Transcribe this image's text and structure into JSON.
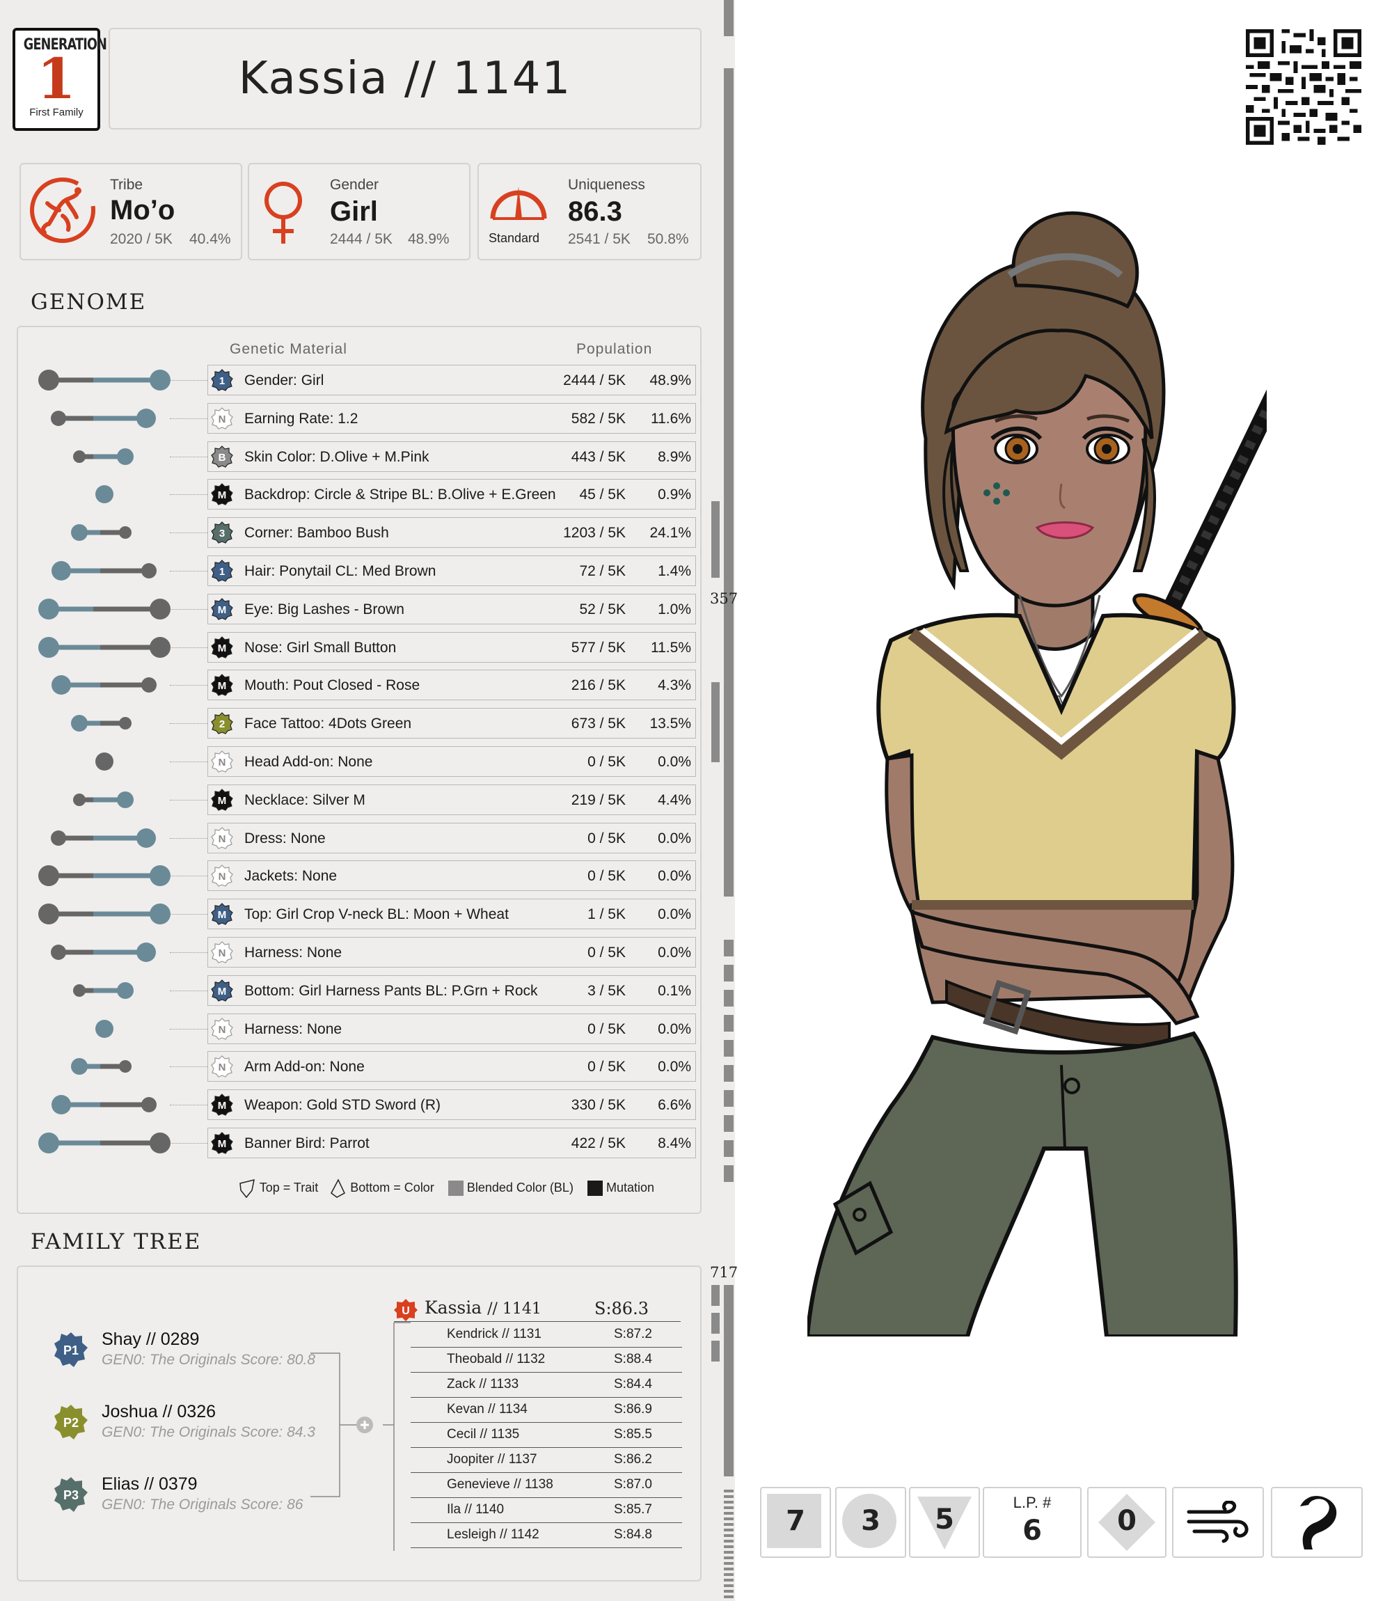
{
  "header": {
    "generation_label": "GENERATION",
    "generation_number": "1",
    "generation_family": "First Family",
    "title": "Kassia  //  1141"
  },
  "stats": {
    "tribe": {
      "label": "Tribe",
      "value": "Mo’o",
      "count": "2020 / 5K",
      "percent": "40.4%"
    },
    "gender": {
      "label": "Gender",
      "value": "Girl",
      "count": "2444 / 5K",
      "percent": "48.9%"
    },
    "uniqueness": {
      "label": "Uniqueness",
      "value": "86.3",
      "gauge_label": "Standard",
      "count": "2541 / 5K",
      "percent": "50.8%"
    }
  },
  "genome": {
    "section_title": "GENOME",
    "col_material": "Genetic Material",
    "col_population": "Population",
    "rows": [
      {
        "badge": "1",
        "badge_color": "#3f5f86",
        "name": "Gender: Girl",
        "pop": "2444 / 5K",
        "pct": "48.9%",
        "allele": "LR"
      },
      {
        "badge": "N",
        "badge_color": "#ffffff",
        "name": "Earning Rate: 1.2",
        "pop": "582 / 5K",
        "pct": "11.6%",
        "allele": "lr"
      },
      {
        "badge": "B",
        "badge_color": "#8a8a8a",
        "name": "Skin Color: D.Olive + M.Pink",
        "pop": "443 / 5K",
        "pct": "8.9%",
        "allele": "s"
      },
      {
        "badge": "M",
        "badge_color": "#111111",
        "name": "Backdrop: Circle & Stripe BL: B.Olive + E.Green",
        "pop": "45 / 5K",
        "pct": "0.9%",
        "allele": "dot_b"
      },
      {
        "badge": "3",
        "badge_color": "#566f6a",
        "name": "Corner: Bamboo Bush",
        "pop": "1203 / 5K",
        "pct": "24.1%",
        "allele": "s2"
      },
      {
        "badge": "1",
        "badge_color": "#3f5f86",
        "name": "Hair: Ponytail  CL: Med Brown",
        "pop": "72 / 5K",
        "pct": "1.4%",
        "allele": "m"
      },
      {
        "badge": "M",
        "badge_color": "#3f5f86",
        "name": "Eye: Big Lashes - Brown",
        "pop": "52 / 5K",
        "pct": "1.0%",
        "allele": "LL"
      },
      {
        "badge": "M",
        "badge_color": "#111111",
        "name": "Nose: Girl Small Button",
        "pop": "577 / 5K",
        "pct": "11.5%",
        "allele": "LL2"
      },
      {
        "badge": "M",
        "badge_color": "#111111",
        "name": "Mouth: Pout Closed - Rose",
        "pop": "216 / 5K",
        "pct": "4.3%",
        "allele": "m"
      },
      {
        "badge": "2",
        "badge_color": "#8a8f2e",
        "name": "Face Tattoo: 4Dots Green",
        "pop": "673 / 5K",
        "pct": "13.5%",
        "allele": "s2"
      },
      {
        "badge": "N",
        "badge_color": "#ffffff",
        "name": "Head Add-on:  None",
        "pop": "0 / 5K",
        "pct": "0.0%",
        "allele": "dot_g"
      },
      {
        "badge": "M",
        "badge_color": "#111111",
        "name": "Necklace: Silver M",
        "pop": "219 / 5K",
        "pct": "4.4%",
        "allele": "s"
      },
      {
        "badge": "N",
        "badge_color": "#ffffff",
        "name": "Dress: None",
        "pop": "0 / 5K",
        "pct": "0.0%",
        "allele": "lr"
      },
      {
        "badge": "N",
        "badge_color": "#ffffff",
        "name": "Jackets: None",
        "pop": "0 / 5K",
        "pct": "0.0%",
        "allele": "LR2"
      },
      {
        "badge": "M",
        "badge_color": "#3f5f86",
        "name": "Top: Girl Crop V-neck BL: Moon + Wheat",
        "pop": "1 / 5K",
        "pct": "0.0%",
        "allele": "LR2"
      },
      {
        "badge": "N",
        "badge_color": "#ffffff",
        "name": "Harness: None",
        "pop": "0 / 5K",
        "pct": "0.0%",
        "allele": "lr"
      },
      {
        "badge": "M",
        "badge_color": "#3f5f86",
        "name": "Bottom: Girl Harness Pants BL: P.Grn + Rock",
        "pop": "3 / 5K",
        "pct": "0.1%",
        "allele": "s"
      },
      {
        "badge": "N",
        "badge_color": "#ffffff",
        "name": "Harness: None",
        "pop": "0 / 5K",
        "pct": "0.0%",
        "allele": "dot_b"
      },
      {
        "badge": "N",
        "badge_color": "#ffffff",
        "name": "Arm Add-on: None",
        "pop": "0 / 5K",
        "pct": "0.0%",
        "allele": "s2"
      },
      {
        "badge": "M",
        "badge_color": "#111111",
        "name": "Weapon: Gold STD Sword (R)",
        "pop": "330 / 5K",
        "pct": "6.6%",
        "allele": "m"
      },
      {
        "badge": "M",
        "badge_color": "#111111",
        "name": "Banner Bird:  Parrot",
        "pop": "422 / 5K",
        "pct": "8.4%",
        "allele": "LL2"
      }
    ],
    "legend": {
      "trait": "Top = Trait",
      "color": "Bottom = Color",
      "blended": "Blended Color (BL)",
      "mutation": "Mutation"
    }
  },
  "family": {
    "section_title": "FAMILY TREE",
    "parents": [
      {
        "tag": "P1",
        "color": "#3f5f86",
        "name": "Shay  //  0289",
        "sub": "GEN0: The Originals Score: 80.8"
      },
      {
        "tag": "P2",
        "color": "#8a8f2e",
        "name": "Joshua  //  0326",
        "sub": "GEN0: The Originals Score: 84.3"
      },
      {
        "tag": "P3",
        "color": "#566f6a",
        "name": "Elias  //  0379",
        "sub": "GEN0: The Originals Score: 86"
      }
    ],
    "self": {
      "badge": "U",
      "name": "Kassia",
      "id": "// 1141",
      "score": "S:86.3"
    },
    "siblings": [
      {
        "name": "Kendrick  //  1131",
        "score": "S:87.2"
      },
      {
        "name": "Theobald  //  1132",
        "score": "S:88.4"
      },
      {
        "name": "Zack  //  1133",
        "score": "S:84.4"
      },
      {
        "name": "Kevan  //  1134",
        "score": "S:86.9"
      },
      {
        "name": "Cecil  //  1135",
        "score": "S:85.5"
      },
      {
        "name": "Joopiter  //  1137",
        "score": "S:86.2"
      },
      {
        "name": "Genevieve  //  1138",
        "score": "S:87.0"
      },
      {
        "name": "Ila  //  1140",
        "score": "S:85.7"
      },
      {
        "name": "Lesleigh  //  1142",
        "score": "S:84.8"
      }
    ]
  },
  "side_ticks": {
    "a": "357",
    "b": "717"
  },
  "bottom_bar": {
    "square": "7",
    "circle": "3",
    "triangle": "5",
    "lp_label": "L.P. #",
    "lp_value": "6",
    "diamond": "0",
    "wind_icon": "wind-icon",
    "bird_icon": "flamingo-icon"
  }
}
